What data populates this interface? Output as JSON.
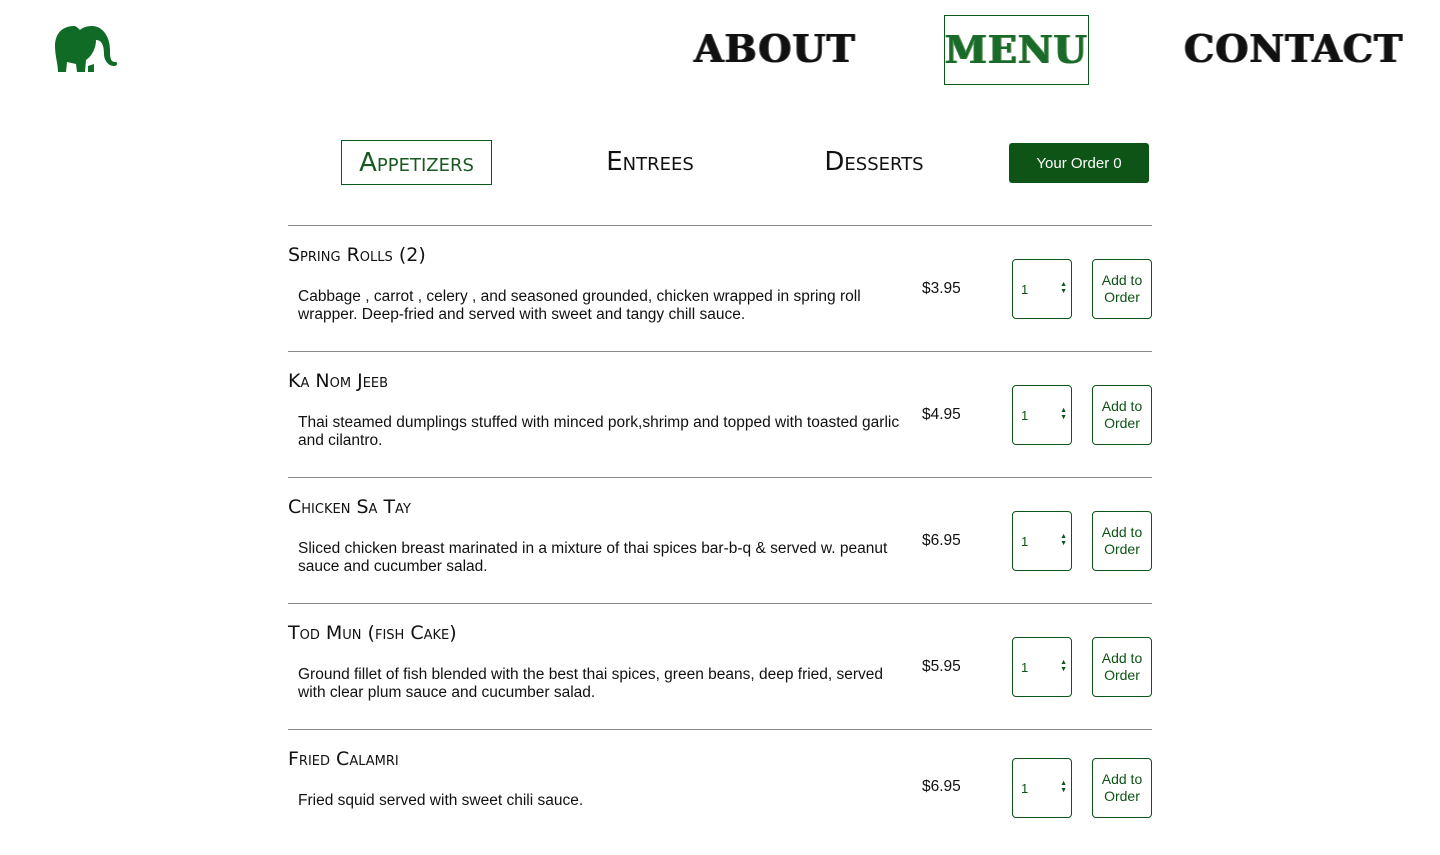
{
  "brand": {
    "logo_icon": "elephant-icon",
    "accent": "#0d5416"
  },
  "topnav": {
    "items": [
      {
        "label": "ABOUT"
      },
      {
        "label": "MENU"
      },
      {
        "label": "CONTACT"
      }
    ],
    "active": "MENU"
  },
  "categories": {
    "items": [
      {
        "label": "Appetizers"
      },
      {
        "label": "Entrees"
      },
      {
        "label": "Desserts"
      }
    ],
    "active": "Appetizers"
  },
  "order": {
    "label": "Your Order",
    "count": "0"
  },
  "menu_items": [
    {
      "name": "Spring Rolls (2)",
      "description": "Cabbage , carrot , celery , and seasoned grounded, chicken wrapped in spring roll wrapper. Deep-fried and served with sweet and tangy chill sauce.",
      "price": "$3.95",
      "qty": "1",
      "add_label": "Add to Order"
    },
    {
      "name": "Ka Nom Jeeb",
      "description": "Thai steamed dumplings stuffed with minced pork,shrimp and topped with toasted garlic and cilantro.",
      "price": "$4.95",
      "qty": "1",
      "add_label": "Add to Order"
    },
    {
      "name": "Chicken Sa Tay",
      "description": "Sliced chicken breast marinated in a mixture of thai spices bar-b-q & served w. peanut sauce and cucumber salad.",
      "price": "$6.95",
      "qty": "1",
      "add_label": "Add to Order"
    },
    {
      "name": "Tod Mun (fish Cake)",
      "description": "Ground fillet of fish blended with the best thai spices, green beans, deep fried, served with clear plum sauce and cucumber salad.",
      "price": "$5.95",
      "qty": "1",
      "add_label": "Add to Order"
    },
    {
      "name": "Fried Calamri",
      "description": "Fried squid served with sweet chili sauce.",
      "price": "$6.95",
      "qty": "1",
      "add_label": "Add to Order"
    }
  ]
}
